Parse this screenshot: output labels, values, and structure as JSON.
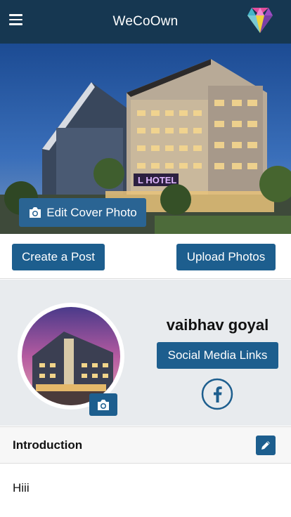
{
  "app_bar": {
    "title": "WeCoOwn",
    "background": "#163751",
    "menu_icon": "hamburger-menu-icon",
    "logo_icon": "gem-logo-icon"
  },
  "cover": {
    "edit_cover_label": "Edit Cover Photo",
    "camera_icon": "camera-icon",
    "hotel_sign_text": "L HOTEL"
  },
  "actions": {
    "create_post_label": "Create a Post",
    "upload_photos_label": "Upload Photos"
  },
  "profile": {
    "name": "vaibhav goyal",
    "social_links_label": "Social Media Links",
    "facebook_icon": "facebook-icon",
    "avatar_camera_icon": "camera-icon"
  },
  "introduction": {
    "title": "Introduction",
    "edit_icon": "pencil-icon",
    "text": "Hiii"
  },
  "colors": {
    "primary": "#1d5e8e",
    "header": "#163751",
    "section_bg": "#e8ebee"
  }
}
